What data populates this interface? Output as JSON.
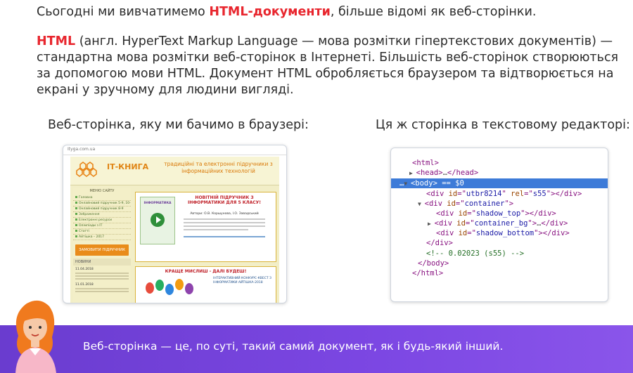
{
  "intro": {
    "before": "Сьогодні ми вивчатимемо ",
    "highlight": "HTML-документи",
    "after": ", більше відомі як веб-сторінки."
  },
  "definition": {
    "term": "HTML",
    "text": " (англ. HyperText Markup Language — мова розмітки гіпертекстових документів) — стандартна мова розмітки веб-сторінок в Інтернеті. Більшість веб-сторінок створюються за допомогою мови HTML. Документ HTML обробляється браузером та відтворюється на екрані у зручному для людини вигляді."
  },
  "captions": {
    "left": "Веб-сторінка, яку ми бачимо в браузері:",
    "right": "Ця ж сторінка в текстовому редакторі:"
  },
  "browser": {
    "url": "Ityga.com.ua",
    "brand": "ІТ-КНИГА",
    "slogan": "традиційні та електронні підручники з інформаційних технологій",
    "menu_head": "МЕНЮ САЙТУ",
    "menu_items": [
      "Головна",
      "Онлайновий підручник 5-9, 10-11 класи",
      "Онлайновий підручник 8-9",
      "Зображення",
      "Електронні ресурси",
      "Олімпіади з ІТ",
      "Статті",
      "Айтішка – 2017"
    ],
    "order_button": "ЗАМОВИТИ ПІДРУЧНИК",
    "news_head": "НОВИНИ",
    "news_dates": [
      "11.04.2018",
      "11.01.2018"
    ],
    "card1_title": "НОВІТНІЙ ПІДРУЧНИК З ІНФОРМАТИКИ ДЛЯ 5 КЛАСУ!",
    "card1_authors": "Автори: О.В. Коршунова, І.О. Завадський",
    "book_title": "ІНФОРМАТИКА",
    "card2_title": "КРАЩЕ МИСЛИШ - ДАЛІ БУДЕШ!",
    "card2_text": "ІНТЕРАКТИВНИЙ КОНКУРС-КВЕСТ З ІНФОРМАТИКИ АЙТІШКА-2018"
  },
  "code": {
    "lines": [
      {
        "tag_open": "<html>"
      },
      {
        "tag_open": "<head>",
        "dots": "…",
        "tag_close": "</head>"
      },
      {
        "tag_open": "<body>",
        "eq": " == $0"
      },
      {
        "div_id": "utbr8214",
        "rel": "s55"
      },
      {
        "div_id": "container"
      },
      {
        "div_id": "shadow_top"
      },
      {
        "div_id": "container_bg"
      },
      {
        "div_id": "shadow_bottom"
      },
      {
        "tag_close": "</div>"
      },
      {
        "comment": "<!-- 0.02023 (s55) -->"
      },
      {
        "tag_close": "</body>"
      },
      {
        "tag_close": "</html>"
      }
    ]
  },
  "banner": {
    "text": "Веб-сторінка — це, по суті, такий самий документ, як і будь-який інший."
  },
  "colors": {
    "accent_red": "#e8262e",
    "banner_purple": "#7c47e3",
    "code_selection": "#3d7bd8"
  }
}
